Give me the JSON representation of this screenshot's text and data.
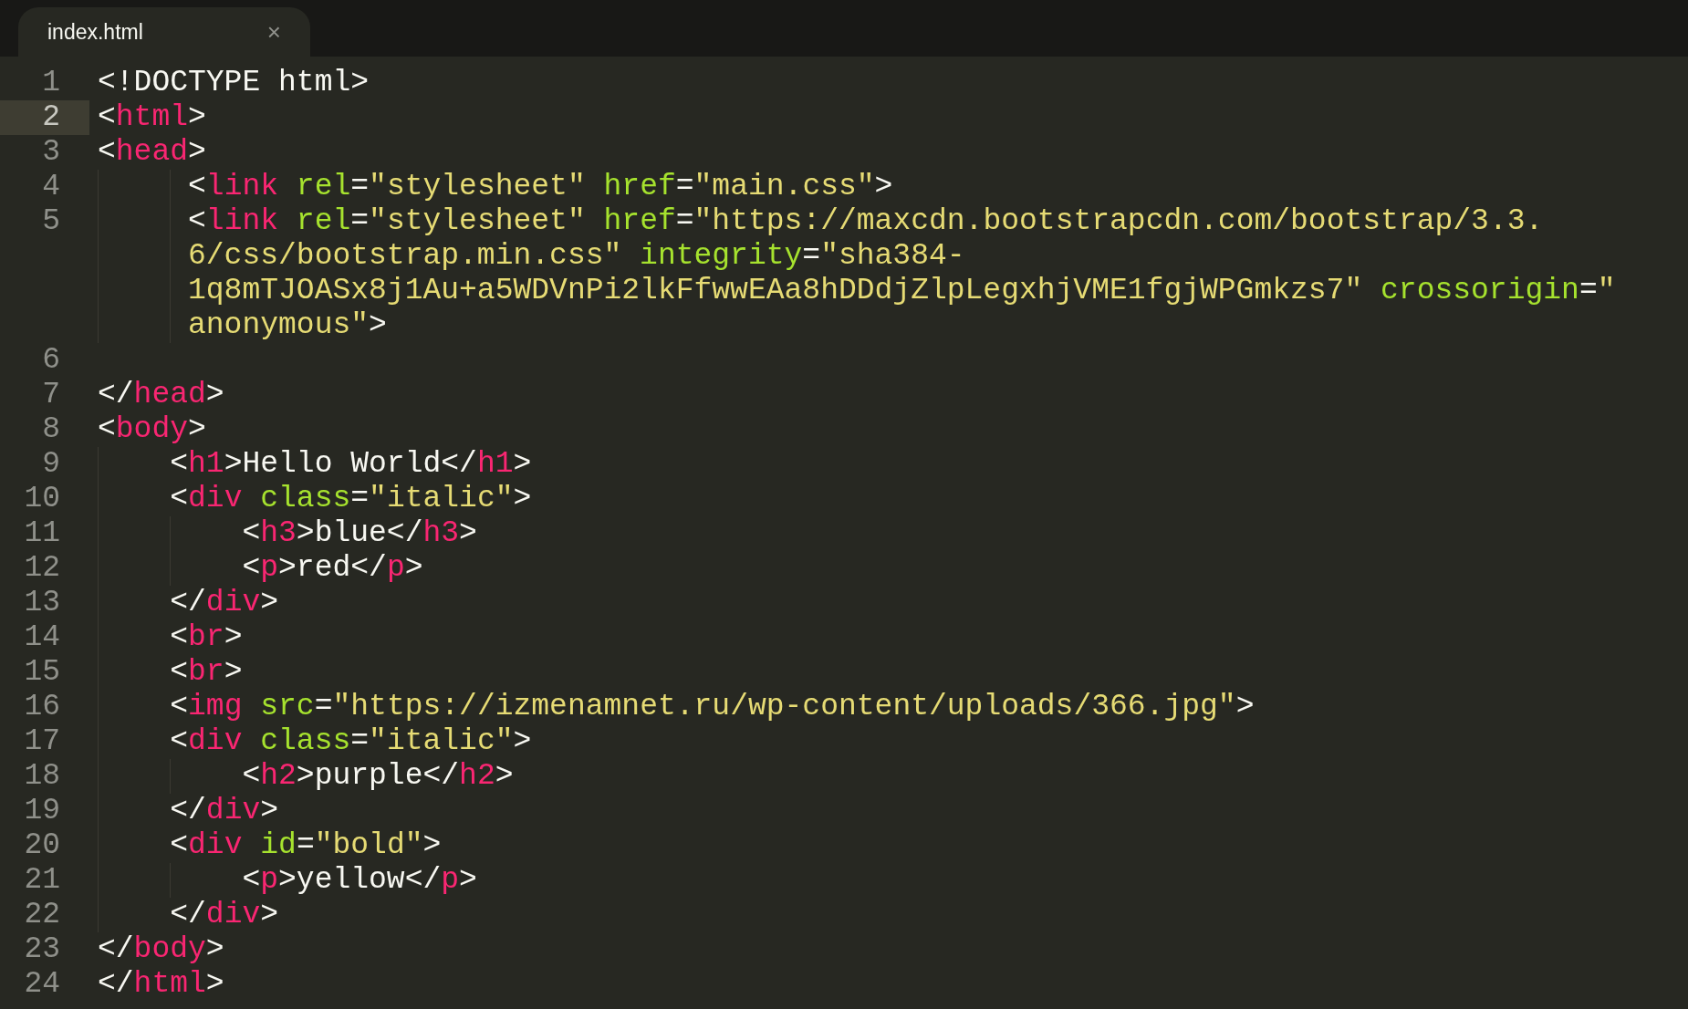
{
  "tabs": [
    {
      "label": "index.html",
      "close": "×",
      "selected": true
    }
  ],
  "lines": [
    {
      "number": "1",
      "current": false,
      "rows": [
        {
          "tokens": [
            {
              "kind": "plain",
              "text": "<!DOCTYPE html>"
            }
          ]
        }
      ]
    },
    {
      "number": "2",
      "current": true,
      "rows": [
        {
          "tokens": [
            {
              "kind": "plain",
              "text": "<"
            },
            {
              "kind": "tag",
              "text": "html"
            },
            {
              "kind": "plain",
              "text": ">"
            }
          ]
        }
      ]
    },
    {
      "number": "3",
      "current": false,
      "rows": [
        {
          "tokens": [
            {
              "kind": "plain",
              "text": "<"
            },
            {
              "kind": "tag",
              "text": "head"
            },
            {
              "kind": "plain",
              "text": ">"
            }
          ]
        }
      ]
    },
    {
      "number": "4",
      "current": false,
      "rows": [
        {
          "tokens": [
            {
              "kind": "plain",
              "text": "     <"
            },
            {
              "kind": "tag",
              "text": "link"
            },
            {
              "kind": "attr",
              "text": " rel"
            },
            {
              "kind": "plain",
              "text": "="
            },
            {
              "kind": "string",
              "text": "\"stylesheet\""
            },
            {
              "kind": "attr",
              "text": " href"
            },
            {
              "kind": "plain",
              "text": "="
            },
            {
              "kind": "string",
              "text": "\"main.css\""
            },
            {
              "kind": "plain",
              "text": ">"
            }
          ]
        }
      ]
    },
    {
      "number": "5",
      "current": false,
      "rows": [
        {
          "tokens": [
            {
              "kind": "plain",
              "text": "     <"
            },
            {
              "kind": "tag",
              "text": "link"
            },
            {
              "kind": "attr",
              "text": " rel"
            },
            {
              "kind": "plain",
              "text": "="
            },
            {
              "kind": "string",
              "text": "\"stylesheet\""
            },
            {
              "kind": "attr",
              "text": " href"
            },
            {
              "kind": "plain",
              "text": "="
            },
            {
              "kind": "string",
              "text": "\"https://maxcdn.bootstrapcdn.com/bootstrap/3.3."
            }
          ]
        },
        {
          "tokens": [
            {
              "kind": "string",
              "text": "     6/css/bootstrap.min.css\""
            },
            {
              "kind": "attr",
              "text": " integrity"
            },
            {
              "kind": "plain",
              "text": "="
            },
            {
              "kind": "string",
              "text": "\"sha384-"
            }
          ]
        },
        {
          "tokens": [
            {
              "kind": "string",
              "text": "     1q8mTJOASx8j1Au+a5WDVnPi2lkFfwwEAa8hDDdjZlpLegxhjVME1fgjWPGmkzs7\""
            },
            {
              "kind": "attr",
              "text": " crossorigin"
            },
            {
              "kind": "plain",
              "text": "="
            },
            {
              "kind": "string",
              "text": "\""
            }
          ]
        },
        {
          "tokens": [
            {
              "kind": "string",
              "text": "     anonymous\""
            },
            {
              "kind": "plain",
              "text": ">"
            }
          ]
        }
      ]
    },
    {
      "number": "6",
      "current": false
    },
    {
      "number": "7",
      "current": false,
      "rows": [
        {
          "tokens": [
            {
              "kind": "plain",
              "text": "</"
            },
            {
              "kind": "tag",
              "text": "head"
            },
            {
              "kind": "plain",
              "text": ">"
            }
          ]
        }
      ]
    },
    {
      "number": "8",
      "current": false,
      "rows": [
        {
          "tokens": [
            {
              "kind": "plain",
              "text": "<"
            },
            {
              "kind": "tag",
              "text": "body"
            },
            {
              "kind": "plain",
              "text": ">"
            }
          ]
        }
      ]
    },
    {
      "number": "9",
      "current": false,
      "rows": [
        {
          "tokens": [
            {
              "kind": "plain",
              "text": "    <"
            },
            {
              "kind": "tag",
              "text": "h1"
            },
            {
              "kind": "plain",
              "text": ">Hello World</"
            },
            {
              "kind": "tag",
              "text": "h1"
            },
            {
              "kind": "plain",
              "text": ">"
            }
          ]
        }
      ]
    },
    {
      "number": "10",
      "current": false,
      "rows": [
        {
          "tokens": [
            {
              "kind": "plain",
              "text": "    <"
            },
            {
              "kind": "tag",
              "text": "div"
            },
            {
              "kind": "attr",
              "text": " class"
            },
            {
              "kind": "plain",
              "text": "="
            },
            {
              "kind": "string",
              "text": "\"italic\""
            },
            {
              "kind": "plain",
              "text": ">"
            }
          ]
        }
      ]
    },
    {
      "number": "11",
      "current": false,
      "rows": [
        {
          "tokens": [
            {
              "kind": "plain",
              "text": "        <"
            },
            {
              "kind": "tag",
              "text": "h3"
            },
            {
              "kind": "plain",
              "text": ">blue</"
            },
            {
              "kind": "tag",
              "text": "h3"
            },
            {
              "kind": "plain",
              "text": ">"
            }
          ]
        }
      ]
    },
    {
      "number": "12",
      "current": false,
      "rows": [
        {
          "tokens": [
            {
              "kind": "plain",
              "text": "        <"
            },
            {
              "kind": "tag",
              "text": "p"
            },
            {
              "kind": "plain",
              "text": ">red</"
            },
            {
              "kind": "tag",
              "text": "p"
            },
            {
              "kind": "plain",
              "text": ">"
            }
          ]
        }
      ]
    },
    {
      "number": "13",
      "current": false,
      "rows": [
        {
          "tokens": [
            {
              "kind": "plain",
              "text": "    </"
            },
            {
              "kind": "tag",
              "text": "div"
            },
            {
              "kind": "plain",
              "text": ">"
            }
          ]
        }
      ]
    },
    {
      "number": "14",
      "current": false,
      "rows": [
        {
          "tokens": [
            {
              "kind": "plain",
              "text": "    <"
            },
            {
              "kind": "tag",
              "text": "br"
            },
            {
              "kind": "plain",
              "text": ">"
            }
          ]
        }
      ]
    },
    {
      "number": "15",
      "current": false,
      "rows": [
        {
          "tokens": [
            {
              "kind": "plain",
              "text": "    <"
            },
            {
              "kind": "tag",
              "text": "br"
            },
            {
              "kind": "plain",
              "text": ">"
            }
          ]
        }
      ]
    },
    {
      "number": "16",
      "current": false,
      "rows": [
        {
          "tokens": [
            {
              "kind": "plain",
              "text": "    <"
            },
            {
              "kind": "tag",
              "text": "img"
            },
            {
              "kind": "attr",
              "text": " src"
            },
            {
              "kind": "plain",
              "text": "="
            },
            {
              "kind": "string",
              "text": "\"https://izmenamnet.ru/wp-content/uploads/366.jpg\""
            },
            {
              "kind": "plain",
              "text": ">"
            }
          ]
        }
      ]
    },
    {
      "number": "17",
      "current": false,
      "rows": [
        {
          "tokens": [
            {
              "kind": "plain",
              "text": "    <"
            },
            {
              "kind": "tag",
              "text": "div"
            },
            {
              "kind": "attr",
              "text": " class"
            },
            {
              "kind": "plain",
              "text": "="
            },
            {
              "kind": "string",
              "text": "\"italic\""
            },
            {
              "kind": "plain",
              "text": ">"
            }
          ]
        }
      ]
    },
    {
      "number": "18",
      "current": false,
      "rows": [
        {
          "tokens": [
            {
              "kind": "plain",
              "text": "        <"
            },
            {
              "kind": "tag",
              "text": "h2"
            },
            {
              "kind": "plain",
              "text": ">purple</"
            },
            {
              "kind": "tag",
              "text": "h2"
            },
            {
              "kind": "plain",
              "text": ">"
            }
          ]
        }
      ]
    },
    {
      "number": "19",
      "current": false,
      "rows": [
        {
          "tokens": [
            {
              "kind": "plain",
              "text": "    </"
            },
            {
              "kind": "tag",
              "text": "div"
            },
            {
              "kind": "plain",
              "text": ">"
            }
          ]
        }
      ]
    },
    {
      "number": "20",
      "current": false,
      "rows": [
        {
          "tokens": [
            {
              "kind": "plain",
              "text": "    <"
            },
            {
              "kind": "tag",
              "text": "div"
            },
            {
              "kind": "attr",
              "text": " id"
            },
            {
              "kind": "plain",
              "text": "="
            },
            {
              "kind": "string",
              "text": "\"bold\""
            },
            {
              "kind": "plain",
              "text": ">"
            }
          ]
        }
      ]
    },
    {
      "number": "21",
      "current": false,
      "rows": [
        {
          "tokens": [
            {
              "kind": "plain",
              "text": "        <"
            },
            {
              "kind": "tag",
              "text": "p"
            },
            {
              "kind": "plain",
              "text": ">yellow</"
            },
            {
              "kind": "tag",
              "text": "p"
            },
            {
              "kind": "plain",
              "text": ">"
            }
          ]
        }
      ]
    },
    {
      "number": "22",
      "current": false,
      "rows": [
        {
          "tokens": [
            {
              "kind": "plain",
              "text": "    </"
            },
            {
              "kind": "tag",
              "text": "div"
            },
            {
              "kind": "plain",
              "text": ">"
            }
          ]
        }
      ]
    },
    {
      "number": "23",
      "current": false,
      "rows": [
        {
          "tokens": [
            {
              "kind": "plain",
              "text": "</"
            },
            {
              "kind": "tag",
              "text": "body"
            },
            {
              "kind": "plain",
              "text": ">"
            }
          ]
        }
      ]
    },
    {
      "number": "24",
      "current": false,
      "rows": [
        {
          "tokens": [
            {
              "kind": "plain",
              "text": "</"
            },
            {
              "kind": "tag",
              "text": "html"
            },
            {
              "kind": "plain",
              "text": ">"
            }
          ]
        }
      ]
    }
  ]
}
